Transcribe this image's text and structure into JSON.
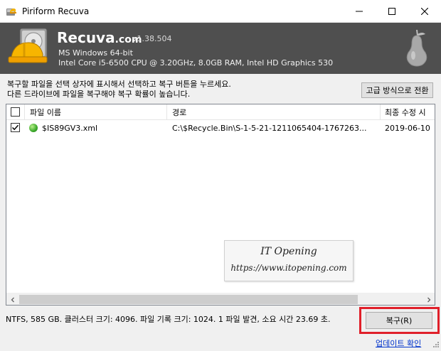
{
  "window": {
    "title": "Piriform Recuva"
  },
  "header": {
    "brand": "Recuva",
    "brand_suffix": ".com",
    "version": "v1.38.504",
    "os": "MS Windows 64-bit",
    "hardware": "Intel Core i5-6500 CPU @ 3.20GHz, 8.0GB RAM, Intel HD Graphics 530"
  },
  "instructions": {
    "line1": "복구할 파일을 선택 상자에 표시해서 선택하고 복구 버튼을 누르세요.",
    "line2": "다른 드라이브에 파일을 복구해야 복구 확률이 높습니다."
  },
  "advanced_button": "고급 방식으로 전환",
  "table": {
    "columns": [
      "파일 이름",
      "경로",
      "최종 수정 시"
    ],
    "rows": [
      {
        "checked": true,
        "status": "green",
        "name": "$IS89GV3.xml",
        "path": "C:\\$Recycle.Bin\\S-1-5-21-1211065404-1767263...",
        "modified": "2019-06-10"
      }
    ]
  },
  "watermark": {
    "title": "IT Opening",
    "url": "https://www.itopening.com"
  },
  "status_text": "NTFS, 585 GB. 클러스터 크기: 4096. 파일 기록 크기: 1024. 1 파일 발견, 소요 시간 23.69 초.",
  "recover_button": "복구(R)",
  "update_link": "업데이트 확인",
  "colors": {
    "header_bg": "#4f4f4f",
    "highlight": "#e0202a",
    "link": "#0033cc"
  }
}
